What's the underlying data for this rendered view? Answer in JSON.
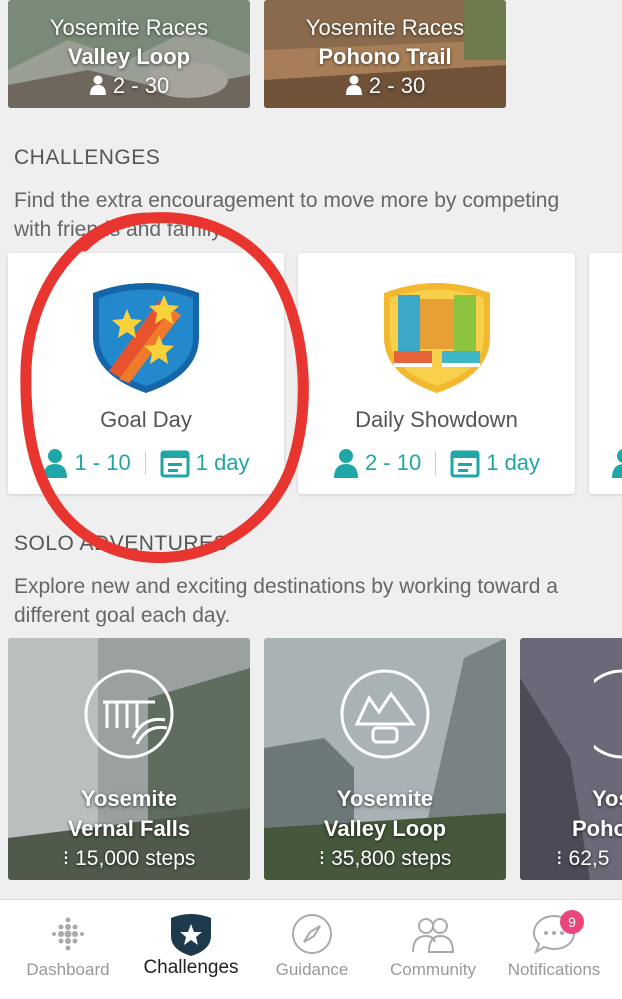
{
  "races": [
    {
      "line1": "Yosemite Races",
      "line2": "Valley Loop",
      "participants": "2 - 30"
    },
    {
      "line1": "Yosemite Races",
      "line2": "Pohono Trail",
      "participants": "2 - 30"
    }
  ],
  "challenges": {
    "title": "CHALLENGES",
    "description": "Find the extra encouragement to move more by competing with friends and family.",
    "cards": [
      {
        "name": "Goal Day",
        "players": "1 - 10",
        "duration": "1 day"
      },
      {
        "name": "Daily Showdown",
        "players": "2 - 10",
        "duration": "1 day"
      }
    ]
  },
  "adventures": {
    "title": "SOLO ADVENTURES",
    "description": "Explore new and exciting destinations by working toward a different goal each day.",
    "cards": [
      {
        "line1": "Yosemite",
        "line2": "Vernal Falls",
        "steps": "15,000 steps"
      },
      {
        "line1": "Yosemite",
        "line2": "Valley Loop",
        "steps": "35,800 steps"
      },
      {
        "line1": "Yos",
        "line2": "Poho",
        "steps": "62,5"
      }
    ]
  },
  "nav": {
    "items": [
      {
        "label": "Dashboard",
        "icon": "dots-icon"
      },
      {
        "label": "Challenges",
        "icon": "star-badge-icon"
      },
      {
        "label": "Guidance",
        "icon": "compass-icon"
      },
      {
        "label": "Community",
        "icon": "people-icon"
      },
      {
        "label": "Notifications",
        "icon": "chat-bubble-icon"
      }
    ],
    "notification_count": "9"
  },
  "colors": {
    "teal": "#1fa6a6",
    "annotation_red": "#e8352f",
    "badge_pink": "#e9467a"
  }
}
